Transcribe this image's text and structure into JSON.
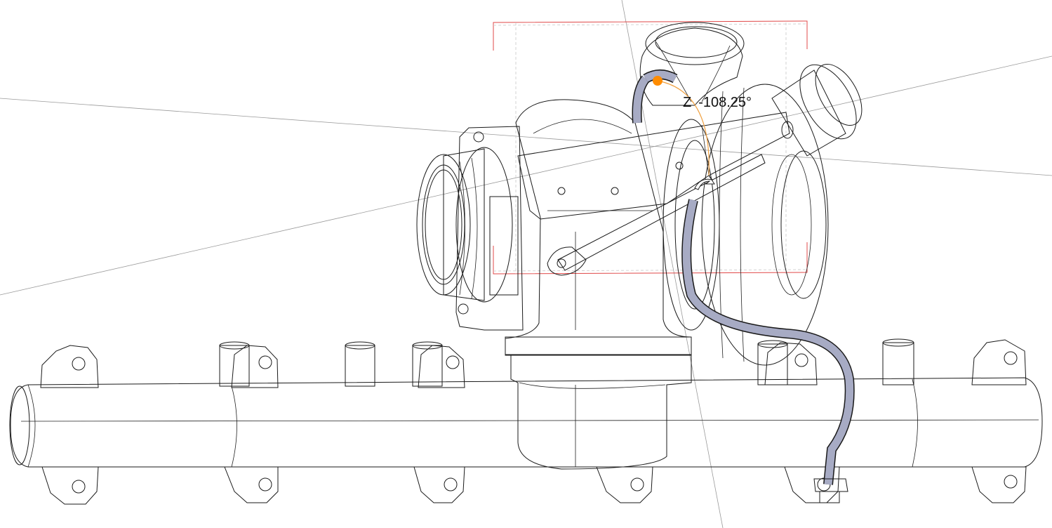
{
  "viewport": {
    "rotation_readout": {
      "axis": "Z",
      "value": "-108.25°"
    }
  },
  "colors": {
    "background": "#ffffff",
    "manifold_dark": "#4a4a4a",
    "manifold_light": "#9b9b9b",
    "turbo_housing": "#dcc29c",
    "turbo_housing_shade": "#a88d66",
    "bracket_blue_gray": "#9fa4bf",
    "bracket_dark": "#6c7190",
    "selection_box": "#e04848",
    "gizmo_handle": "#ff8c00",
    "gizmo_arc": "#f0a040"
  },
  "model": {
    "parts": [
      "exhaust-manifold",
      "turbocharger",
      "wastegate-actuator",
      "bracket",
      "oil-line"
    ]
  }
}
